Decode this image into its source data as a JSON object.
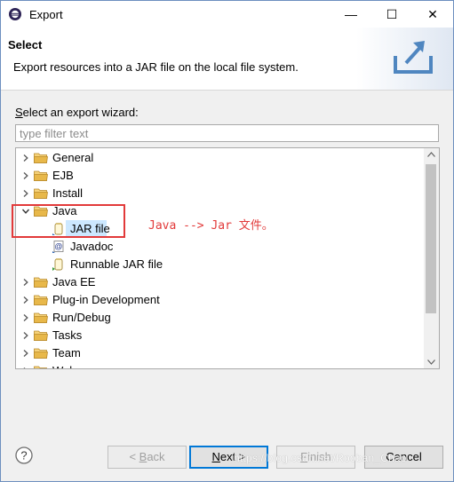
{
  "window": {
    "title": "Export",
    "minimize_glyph": "—",
    "maximize_glyph": "☐",
    "close_glyph": "✕"
  },
  "header": {
    "title": "Select",
    "description": "Export resources into a JAR file on the local file system.",
    "icon": "export-wizard-icon"
  },
  "wizard": {
    "label_mnemonic": "S",
    "label_rest": "elect an export wizard:",
    "filter_placeholder": "type filter text",
    "filter_value": ""
  },
  "tree": {
    "items": [
      {
        "label": "General",
        "icon": "folder-icon",
        "expanded": false
      },
      {
        "label": "EJB",
        "icon": "folder-icon",
        "expanded": false
      },
      {
        "label": "Install",
        "icon": "folder-icon",
        "expanded": false
      },
      {
        "label": "Java",
        "icon": "folder-icon",
        "expanded": true
      },
      {
        "label": "JAR file",
        "icon": "jar-icon",
        "selected": true
      },
      {
        "label": "Javadoc",
        "icon": "javadoc-icon"
      },
      {
        "label": "Runnable JAR file",
        "icon": "runnable-jar-icon"
      },
      {
        "label": "Java EE",
        "icon": "folder-icon",
        "expanded": false
      },
      {
        "label": "Plug-in Development",
        "icon": "folder-icon",
        "expanded": false
      },
      {
        "label": "Run/Debug",
        "icon": "folder-icon",
        "expanded": false
      },
      {
        "label": "Tasks",
        "icon": "folder-icon",
        "expanded": false
      },
      {
        "label": "Team",
        "icon": "folder-icon",
        "expanded": false
      },
      {
        "label": "Web",
        "icon": "folder-icon",
        "expanded": false
      }
    ]
  },
  "annotation": {
    "text": "Java --> Jar 文件。",
    "color": "#e23a3a"
  },
  "buttons": {
    "back": {
      "prefix": "< ",
      "mnemonic": "B",
      "rest": "ack"
    },
    "next": {
      "mnemonic": "N",
      "rest": "ext >"
    },
    "finish": {
      "mnemonic": "F",
      "rest": "inish"
    },
    "cancel": "Cancel"
  },
  "watermark": "https://blog.csdn.net/Rooban_Chao",
  "colors": {
    "accent": "#0078d7",
    "selection": "#cce8ff",
    "annotation": "#e23a3a",
    "folder": "#e8b84a"
  }
}
